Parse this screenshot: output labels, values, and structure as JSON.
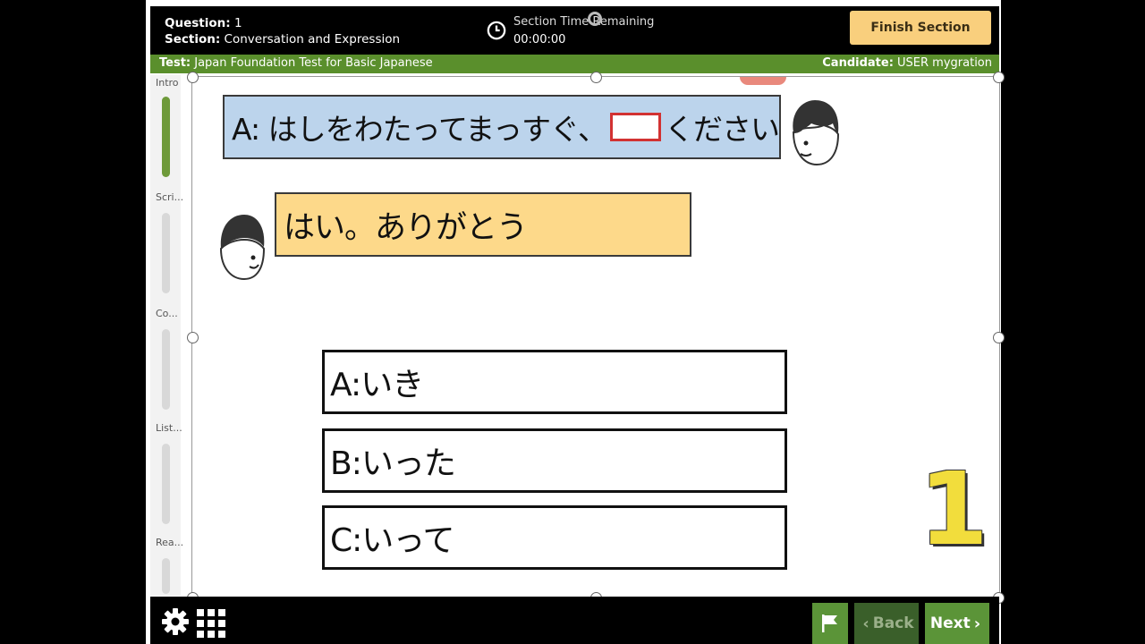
{
  "header": {
    "question_label": "Question:",
    "question_value": "1",
    "section_label": "Section:",
    "section_value": "Conversation and Expression",
    "timer_label": "Section Time Remaining",
    "timer_value": "00:00:00",
    "finish_button": "Finish Section"
  },
  "infobar": {
    "test_label": "Test:",
    "test_value": "Japan Foundation Test for Basic Japanese",
    "candidate_label": "Candidate:",
    "candidate_value": "USER mygration"
  },
  "sidebar": {
    "items": [
      {
        "label": "Intro",
        "active": true
      },
      {
        "label": "Scri..."
      },
      {
        "label": "Co..."
      },
      {
        "label": "List..."
      },
      {
        "label": "Rea..."
      }
    ]
  },
  "question": {
    "prompt_before": "A: はしをわたってまっすぐ、",
    "prompt_after": "ください",
    "reply": "はい。ありがとう",
    "options": [
      "A:いき",
      "B:いった",
      "C:いって"
    ],
    "number": "1"
  },
  "footer": {
    "back_label": "Back",
    "next_label": "Next"
  },
  "colors": {
    "accent_green": "#5a8f2c",
    "finish_button": "#f9cf7d",
    "question_box": "#bcd4ec",
    "reply_box": "#fdd98a",
    "blank_border": "#d23232"
  },
  "icons": [
    "clock-icon",
    "settings-gear-icon",
    "grid-menu-icon",
    "flag-icon",
    "chevron-left-icon",
    "chevron-right-icon"
  ]
}
